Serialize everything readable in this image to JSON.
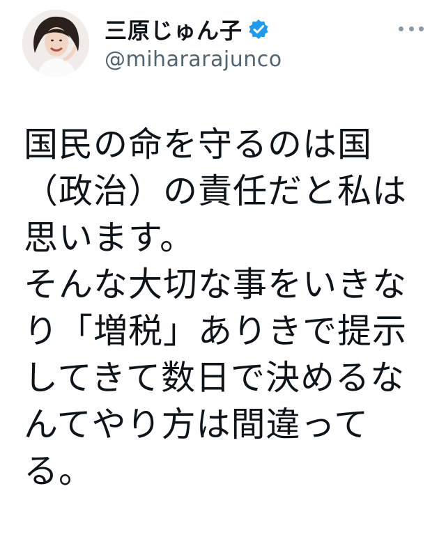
{
  "author": {
    "display_name": "三原じゅん子",
    "handle": "@mihararajunco",
    "verified": true,
    "avatar_icon": "profile-photo",
    "verified_icon": "verified-badge-icon",
    "more_icon": "more-options-icon"
  },
  "tweet": {
    "lines": [
      "国民の命を守るのは国",
      "（政治）の責任だと私は",
      "思います。",
      "そんな大切な事をいきな",
      "り「増税」ありきで提示",
      "してきて数日で決めるな",
      "んてやり方は間違って",
      "る。"
    ]
  },
  "colors": {
    "text": "#0f1419",
    "secondary_text": "#536471",
    "verified": "#1d9bf0",
    "more_dots": "#8b98a5",
    "background": "#ffffff"
  }
}
